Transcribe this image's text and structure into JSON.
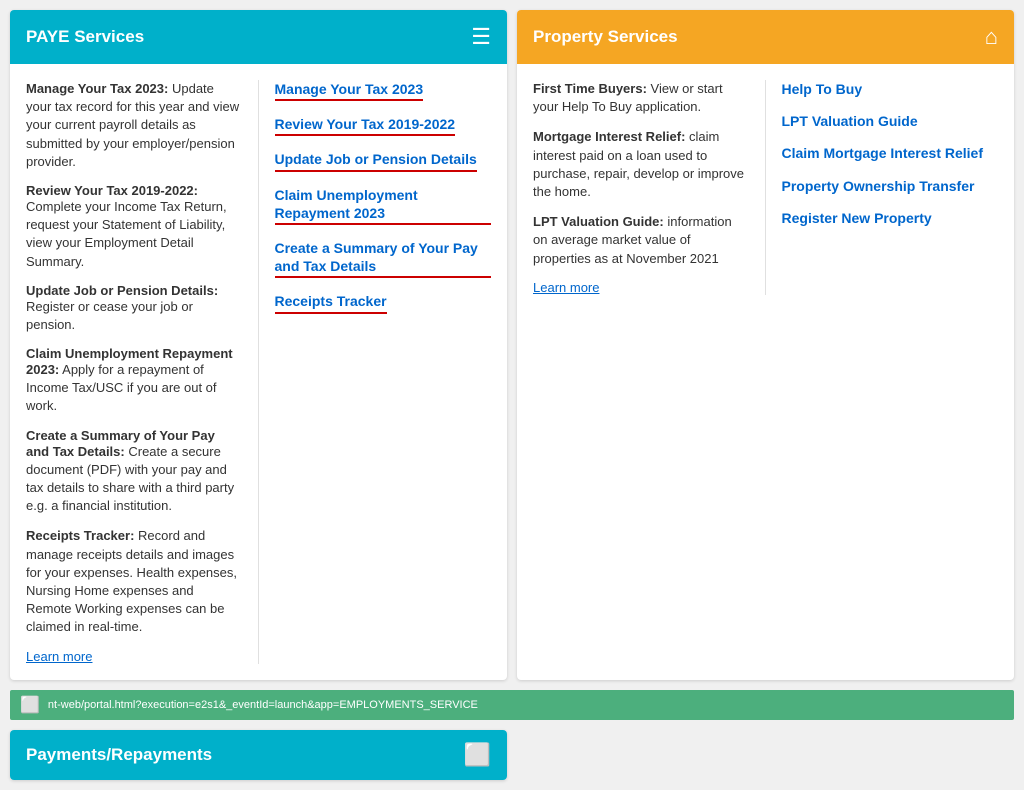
{
  "paye": {
    "header_title": "PAYE Services",
    "header_icon": "☰",
    "left": {
      "items": [
        {
          "title": "Manage Your Tax 2023:",
          "text": "Update your tax record for this year and view your current payroll details as submitted by your employer/pension provider."
        },
        {
          "title": "Review Your Tax 2019-2022:",
          "text": "Complete your Income Tax Return, request your Statement of Liability, view your Employment Detail Summary."
        },
        {
          "title": "Update Job or Pension Details:",
          "text": "Register or cease your job or pension."
        },
        {
          "title": "Claim Unemployment Repayment 2023:",
          "text": "Apply for a repayment of Income Tax/USC if you are out of work."
        },
        {
          "title": "Create a Summary of Your Pay and Tax Details:",
          "text": "Create a secure document (PDF) with your pay and tax details to share with a third party e.g. a financial institution."
        },
        {
          "title": "Receipts Tracker:",
          "text": "Record and manage receipts details and images for your expenses. Health expenses, Nursing Home expenses and Remote Working expenses can be claimed in real-time."
        }
      ],
      "learn_more": "Learn more"
    },
    "right": {
      "links": [
        "Manage Your Tax 2023",
        "Review Your Tax 2019-2022",
        "Update Job or Pension Details",
        "Claim Unemployment Repayment 2023",
        "Create a Summary of Your Pay and Tax Details",
        "Receipts Tracker"
      ]
    }
  },
  "property": {
    "header_title": "Property Services",
    "header_icon": "⌂",
    "left": {
      "items": [
        {
          "title": "First Time Buyers:",
          "text": "View or start your Help To Buy application."
        },
        {
          "title": "Mortgage Interest Relief:",
          "text": "claim interest paid on a loan used to purchase, repair, develop or improve the home."
        },
        {
          "title": "LPT Valuation Guide:",
          "text": "information on average market value of properties as at November 2021"
        }
      ],
      "learn_more": "Learn more"
    },
    "right": {
      "links": [
        "Help To Buy",
        "LPT Valuation Guide",
        "Claim Mortgage Interest Relief",
        "Property Ownership Transfer",
        "Register New Property"
      ]
    }
  },
  "payments": {
    "header_title": "Payments/Repayments",
    "header_icon": "💳"
  },
  "bottom_bar": {
    "url": "nt-web/portal.html?execution=e2s1&_eventId=launch&app=EMPLOYMENTS_SERVICE",
    "icon": "⬜"
  }
}
